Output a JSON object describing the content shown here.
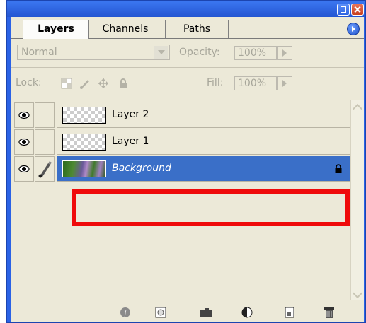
{
  "panel": {
    "tabs": [
      {
        "label": "Layers",
        "active": true
      },
      {
        "label": "Channels",
        "active": false
      },
      {
        "label": "Paths",
        "active": false
      }
    ]
  },
  "blend": {
    "mode": "Normal",
    "opacity_label": "Opacity:",
    "opacity_value": "100%"
  },
  "lock": {
    "label": "Lock:",
    "fill_label": "Fill:",
    "fill_value": "100%"
  },
  "layers": [
    {
      "name": "Layer 2",
      "visible": true,
      "selected": false,
      "thumbnail": "transparent"
    },
    {
      "name": "Layer 1",
      "visible": true,
      "selected": false,
      "thumbnail": "transparent"
    },
    {
      "name": "Background",
      "visible": true,
      "selected": true,
      "locked": true,
      "thumbnail": "photo"
    }
  ],
  "colors": {
    "selection": "#3a6fc8",
    "highlight_box": "#ef0b0b",
    "titlebar": "#2a62e6"
  },
  "icons": {
    "bottom_bar": [
      "layer-style-icon",
      "mask-icon",
      "new-group-icon",
      "adjustment-layer-icon",
      "new-layer-icon",
      "trash-icon"
    ]
  }
}
